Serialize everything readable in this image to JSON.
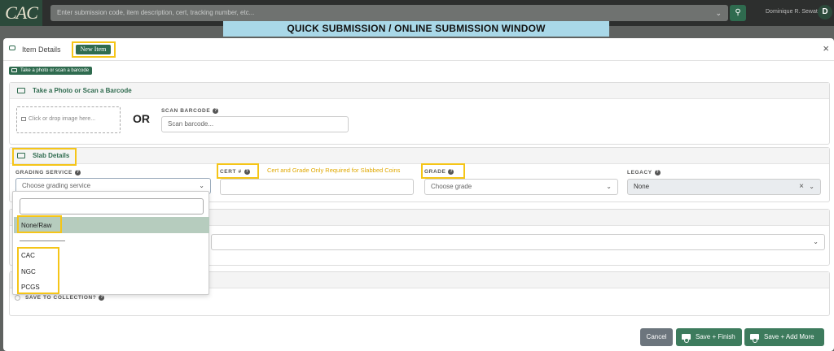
{
  "app": {
    "logo": "CAC",
    "search_placeholder": "Enter submission code, item description, cert, tracking number, etc...",
    "user_name": "Dominique R. Sewat",
    "user_initial": "D"
  },
  "banner": "QUICK SUBMISSION / ONLINE SUBMISSION WINDOW",
  "modal": {
    "title": "Item Details",
    "badge": "New Item",
    "photo_chip": "Take a photo or scan a barcode"
  },
  "photo_section": {
    "title": "Take a Photo or Scan a Barcode",
    "dropzone": "Click or drop image here...",
    "or": "OR",
    "scan_label": "SCAN BARCODE",
    "scan_placeholder": "Scan barcode..."
  },
  "slab_section": {
    "title": "Slab Details",
    "grading_label": "GRADING SERVICE",
    "grading_placeholder": "Choose grading service",
    "cert_label": "CERT #",
    "note": "Cert and Grade Only Required for Slabbed Coins",
    "grade_label": "GRADE",
    "grade_placeholder": "Choose grade",
    "legacy_label": "LEGACY",
    "legacy_value": "None"
  },
  "dropdown": {
    "options": [
      "None/Raw",
      "CAC",
      "NGC",
      "PCGS"
    ]
  },
  "collection": {
    "label": "SAVE TO COLLECTION?"
  },
  "footer": {
    "cancel": "Cancel",
    "save_finish": "Save + Finish",
    "save_add_more": "Save + Add More"
  },
  "colors": {
    "brand_green": "#2f6b4f",
    "highlight": "#f5c518",
    "banner": "#a9d8e8"
  }
}
